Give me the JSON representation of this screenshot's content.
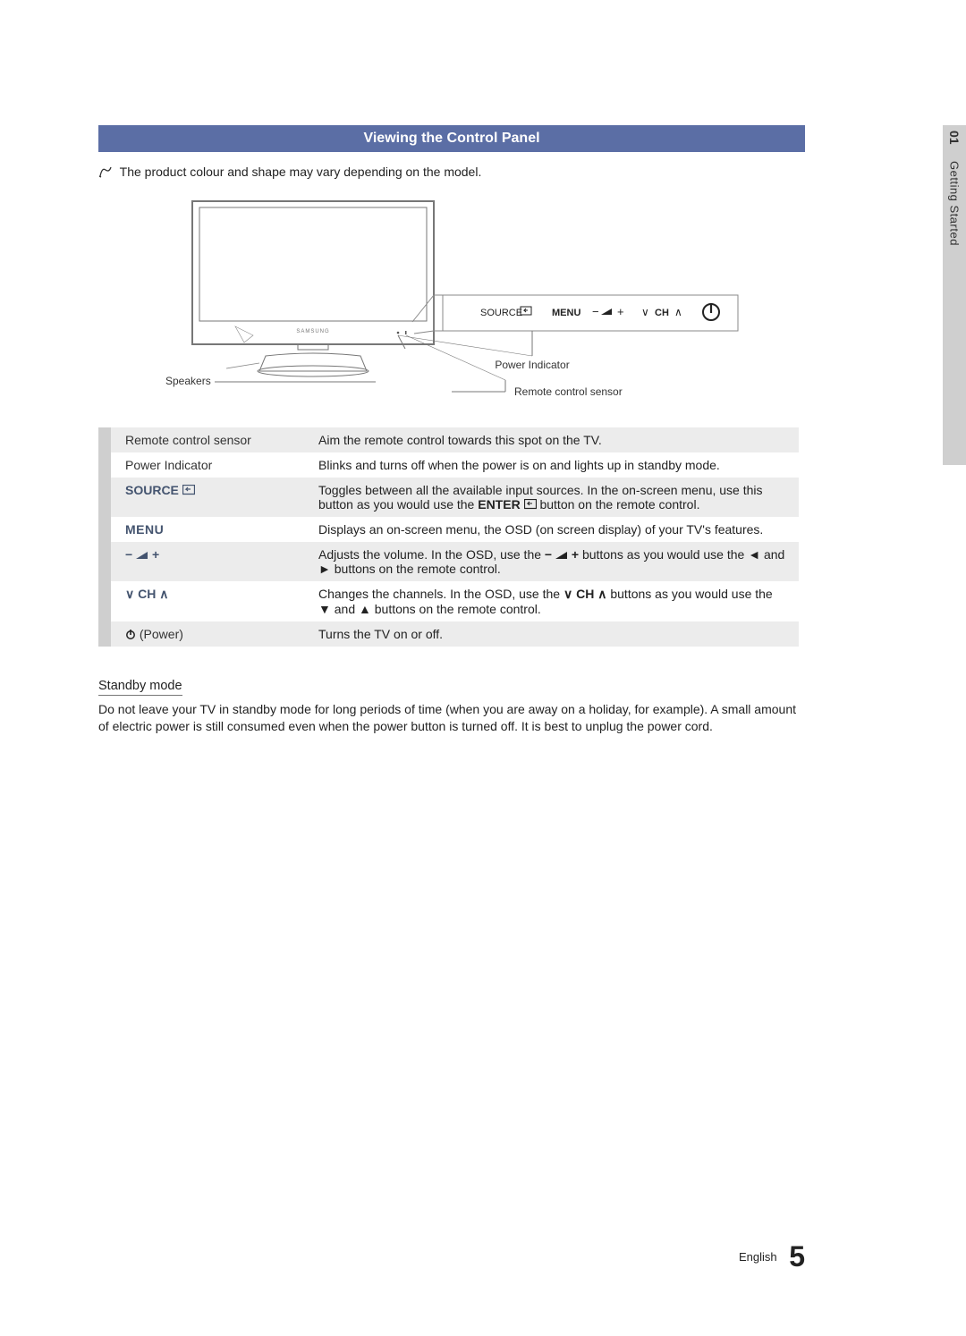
{
  "side_tab": {
    "chapter": "01",
    "title": "Getting Started"
  },
  "section_title": "Viewing the Control Panel",
  "note": "The product colour and shape may vary depending on the model.",
  "diagram": {
    "panel_labels": {
      "source": "SOURCE",
      "menu": "MENU",
      "vol_minus": "−",
      "vol_plus": "+",
      "ch": "CH"
    },
    "callouts": {
      "power_indicator": "Power Indicator",
      "remote_sensor": "Remote control sensor",
      "speakers": "Speakers"
    }
  },
  "rows": [
    {
      "label": "Remote control sensor",
      "label_style": "normal",
      "desc": "Aim the remote control towards this spot on the TV."
    },
    {
      "label": "Power Indicator",
      "label_style": "normal",
      "desc": "Blinks and turns off when the power is on and lights up in standby mode."
    },
    {
      "label": "SOURCE",
      "label_style": "source",
      "desc_pre": "Toggles between all the available input sources. In the on-screen menu, use this button as you would use the ",
      "desc_kw": "ENTER",
      "desc_post": " button on the remote control."
    },
    {
      "label": "MENU",
      "label_style": "bold",
      "desc": "Displays an on-screen menu, the OSD (on screen display) of your TV's features."
    },
    {
      "label": "vol",
      "label_style": "vol",
      "desc_pre": "Adjusts the volume. In the OSD, use the ",
      "desc_mid": " buttons as you would use the ◄ and ► buttons on the remote control."
    },
    {
      "label": "ch",
      "label_style": "ch",
      "desc_pre": "Changes the channels. In the OSD, use the ",
      "desc_mid_kw": "CH",
      "desc_post": " buttons as you would use the ▼ and ▲ buttons on the remote control."
    },
    {
      "label": "(Power)",
      "label_style": "power",
      "desc": "Turns the TV on or off."
    }
  ],
  "standby": {
    "heading": "Standby mode",
    "body": "Do not leave your TV in standby mode for long periods of time (when you are away on a holiday, for example). A small amount of electric power is still consumed even when the power button is turned off. It is best to unplug the power cord."
  },
  "footer": {
    "language": "English",
    "page": "5"
  },
  "glyphs": {
    "minus": "−",
    "plus": "+",
    "ch_down": "∨",
    "ch_up": "∧"
  }
}
